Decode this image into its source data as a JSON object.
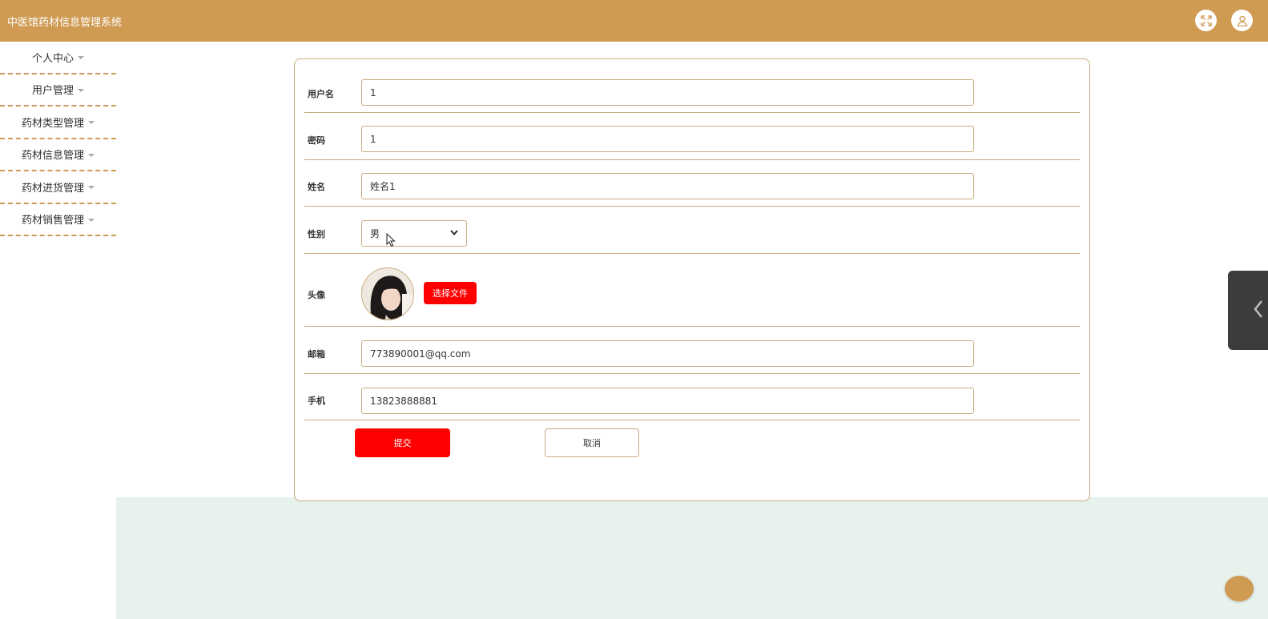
{
  "header": {
    "title": "中医馆药材信息管理系统",
    "icons": [
      "fullscreen-icon",
      "user-icon"
    ]
  },
  "sidebar": {
    "items": [
      {
        "label": "个人中心"
      },
      {
        "label": "用户管理"
      },
      {
        "label": "药材类型管理"
      },
      {
        "label": "药材信息管理"
      },
      {
        "label": "药材进货管理"
      },
      {
        "label": "药材销售管理"
      }
    ]
  },
  "form": {
    "username": {
      "label": "用户名",
      "value": "1"
    },
    "password": {
      "label": "密码",
      "value": "1"
    },
    "name": {
      "label": "姓名",
      "value": "姓名1"
    },
    "gender": {
      "label": "性别",
      "value": "男"
    },
    "avatar": {
      "label": "头像",
      "upload_label": "选择文件"
    },
    "email": {
      "label": "邮箱",
      "value": "773890001@qq.com"
    },
    "phone": {
      "label": "手机",
      "value": "13823888881"
    },
    "submit_label": "提交",
    "cancel_label": "取消"
  },
  "colors": {
    "brand": "#cf9a52",
    "primary_button": "#ff0000",
    "border": "#c9aa7e",
    "bottom_band": "#e8f2ec",
    "side_tab": "#3c3c3c"
  }
}
